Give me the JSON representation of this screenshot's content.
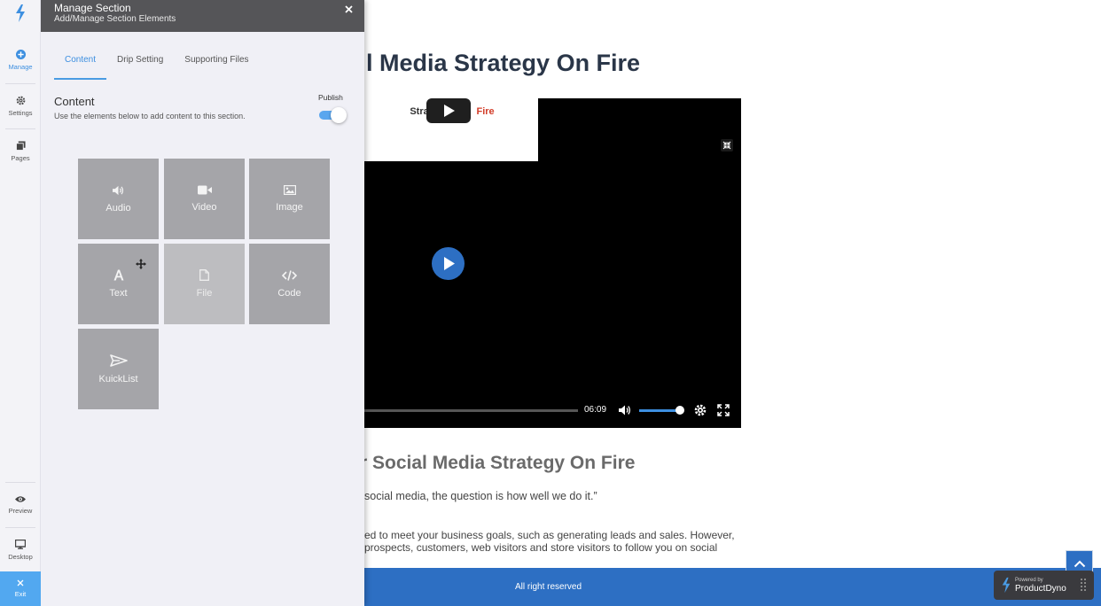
{
  "rail": {
    "items": [
      {
        "label": "Manage",
        "icon": "plus-circle-icon"
      },
      {
        "label": "Settings",
        "icon": "gear-icon"
      },
      {
        "label": "Pages",
        "icon": "pages-icon"
      },
      {
        "label": "Preview",
        "icon": "eye-icon"
      },
      {
        "label": "Desktop",
        "icon": "monitor-icon"
      },
      {
        "label": "Exit",
        "icon": "close-icon"
      }
    ]
  },
  "panel": {
    "title": "Manage Section",
    "subtitle": "Add/Manage Section Elements",
    "tabs": [
      {
        "label": "Content",
        "active": true
      },
      {
        "label": "Drip Setting",
        "active": false
      },
      {
        "label": "Supporting Files",
        "active": false
      }
    ],
    "section_title": "Content",
    "section_desc": "Use the elements below to add content to this section.",
    "publish_label": "Publish",
    "publish_on": true,
    "elements": [
      {
        "label": "Audio",
        "icon": "volume-icon"
      },
      {
        "label": "Video",
        "icon": "video-camera-icon"
      },
      {
        "label": "Image",
        "icon": "image-icon"
      },
      {
        "label": "Text",
        "icon": "text-a-icon"
      },
      {
        "label": "File",
        "icon": "file-icon"
      },
      {
        "label": "Code",
        "icon": "code-icon"
      },
      {
        "label": "KuickList",
        "icon": "send-icon"
      }
    ]
  },
  "page": {
    "heading": "l Media Strategy On Fire",
    "video": {
      "thumb_line1": "Strat",
      "thumb_line1_red": "Fire",
      "time": "06:09",
      "progress": 0,
      "volume": 0.85
    },
    "heading2": "r Social Media Strategy On Fire",
    "quote": "social media, the question is how well we do it.”",
    "paragraph_lines": [
      "ed to meet your business goals, such as generating leads and sales. However,",
      "prospects, customers, web visitors and store visitors to follow you on social"
    ],
    "footer_text": "All right reserved"
  },
  "badge": {
    "small": "Powered by",
    "brand": "ProductDyno"
  },
  "colors": {
    "accent": "#3d8fe0",
    "footer": "#2d6fc3",
    "header": "#555558",
    "tile": "#a5a5a9"
  }
}
